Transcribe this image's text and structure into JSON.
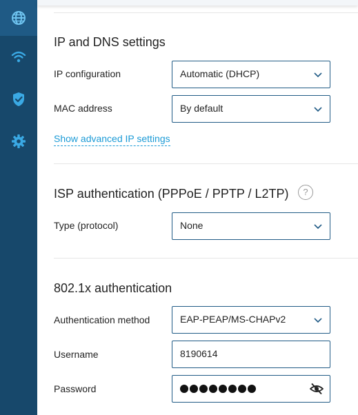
{
  "sidebar": {
    "items": [
      {
        "name": "internet",
        "icon": "globe-icon",
        "active": true
      },
      {
        "name": "wifi",
        "icon": "wifi-icon",
        "active": false
      },
      {
        "name": "security",
        "icon": "shield-check-icon",
        "active": false
      },
      {
        "name": "settings",
        "icon": "gear-icon",
        "active": false
      }
    ],
    "color": "#17486b"
  },
  "ip_dns": {
    "title": "IP and DNS settings",
    "ip_config_label": "IP configuration",
    "ip_config_value": "Automatic (DHCP)",
    "mac_label": "MAC address",
    "mac_value": "By default",
    "advanced_link": "Show advanced IP settings"
  },
  "isp_auth": {
    "title": "ISP authentication (PPPoE / PPTP / L2TP)",
    "help_icon": "?",
    "type_label": "Type (protocol)",
    "type_value": "None"
  },
  "dot1x": {
    "title": "802.1x authentication",
    "method_label": "Authentication method",
    "method_value": "EAP-PEAP/MS-CHAPv2",
    "username_label": "Username",
    "username_value": "8190614",
    "password_label": "Password",
    "password_length": 8
  },
  "colors": {
    "accent": "#1a9ad6",
    "field_border": "#1f5a85"
  }
}
